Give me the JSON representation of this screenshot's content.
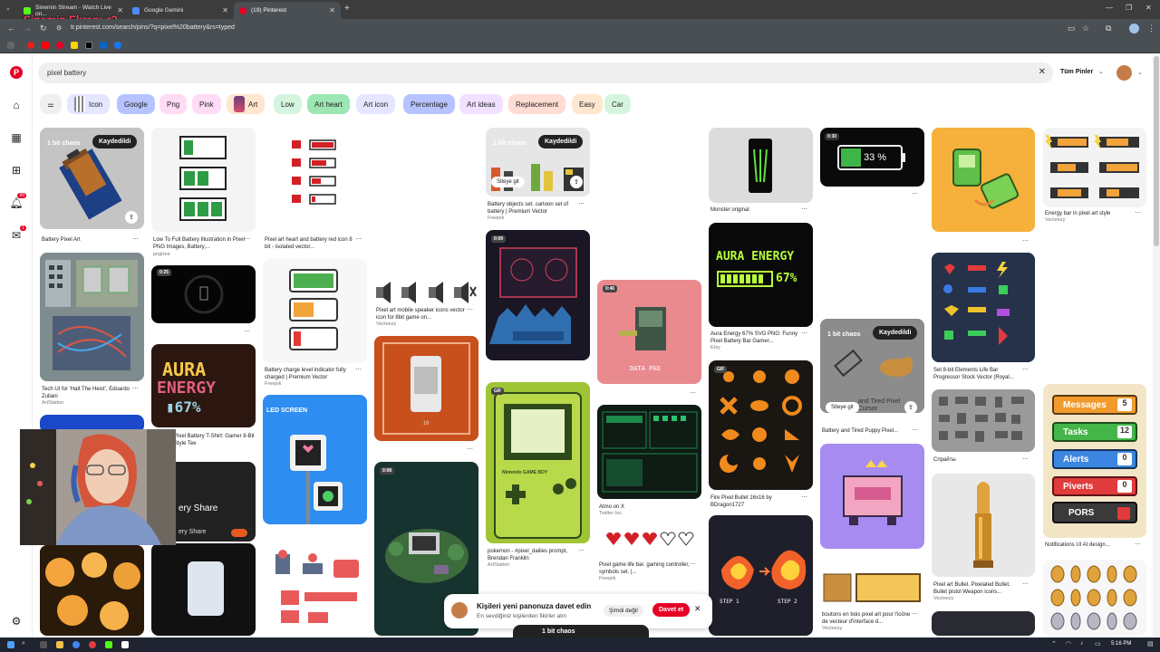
{
  "overlay": {
    "stream_title": "Sinemin Ekranı <3"
  },
  "browser": {
    "tabs": [
      {
        "title": "Sinemin Stream - Watch Live on...",
        "active": false,
        "favicon_color": "#53fc18"
      },
      {
        "title": "Google Gemini",
        "active": false,
        "favicon_color": "#4e8cf7"
      },
      {
        "title": "(19) Pinterest",
        "active": true,
        "favicon_color": "#e60023"
      }
    ],
    "url": "tr.pinterest.com/search/pins/?q=pixel%20battery&rs=typed",
    "bookmark_colors": [
      "#e62117",
      "#ff0000",
      "#e60023",
      "#ffd600",
      "#000000",
      "#0a66c2",
      "#1877f2"
    ]
  },
  "pinterest": {
    "search_query": "pixel battery",
    "all_pins_label": "Tüm Pinler",
    "notifications_badge": "99",
    "messages_badge": "1",
    "chips": [
      {
        "label": "Icon",
        "color": "#e4e7ff"
      },
      {
        "label": "Google",
        "color": "#b7c3ff"
      },
      {
        "label": "Png",
        "color": "#ffdcf5"
      },
      {
        "label": "Pink",
        "color": "#ffdcf5"
      },
      {
        "label": "Art",
        "color": "#ffe6cf"
      },
      {
        "label": "Low",
        "color": "#d6f5df"
      },
      {
        "label": "Art heart",
        "color": "#9ce7b3"
      },
      {
        "label": "Art icon",
        "color": "#e4e7ff"
      },
      {
        "label": "Percentage",
        "color": "#b7c3ff"
      },
      {
        "label": "Art ideas",
        "color": "#f1e0ff"
      },
      {
        "label": "Replacement",
        "color": "#ffdcd4"
      },
      {
        "label": "Easy",
        "color": "#ffe6cf"
      },
      {
        "label": "Car",
        "color": "#d6f5df"
      }
    ],
    "pins": {
      "p1": {
        "caption": "Battery Pixel Art",
        "board": "1 bit chaos",
        "save": "Kaydedildi"
      },
      "p2": {
        "caption": "Low To Full Battery Illustration in Pixel PNG Images, Battery,...",
        "source": "pngtree"
      },
      "p3": {
        "caption": "Pixel art heart and battery red icon 8 bit - isolated vector..."
      },
      "p4": {
        "caption": "Battery objects set. cartoon set of battery | Premium Vector",
        "source": "Freepik",
        "board": "1 bit chaos",
        "save": "Kaydedildi",
        "site": "Siteye git"
      },
      "p5": {
        "caption": "Monster original"
      },
      "p6": {
        "text": "33 %",
        "badge": "0:30"
      },
      "p7": {
        "caption": "Energy bar in pixel art style",
        "source": "Vecteezy"
      },
      "p8": {
        "caption": "Tech UI for 'Halt The Heist', Edoardo Zuliani",
        "source": "ArtStation"
      },
      "p9": {
        "caption": "Pixel art mobile speaker icons vector icon for 8bit game on...",
        "source": "Vecteezy"
      },
      "p10": {
        "caption": "Battery charge level indicator fully charged | Premium Vector",
        "source": "Freepik"
      },
      "p11": {
        "text": "AURA ENERGY 67%",
        "caption": "Aura Energy 67% SVG PNG: Funny Pixel Battery Bar Gamer...",
        "source": "Etsy"
      },
      "p12": {
        "text": "DATA PAD",
        "badge": "0:46"
      },
      "p13": {
        "caption": "Set 8-bit Elements Life Bar Progressor Stock Vector (Royal..."
      },
      "p14": {
        "caption": "Battery and Tired Puppy Pixel...",
        "board": "1 bit chaos",
        "save": "Kaydedildi",
        "site": "Siteye git",
        "overlay_text": "and Tired Pixel Cursor"
      },
      "p15": {
        "text": "AURA ENERGY 67%",
        "caption": "Pixel Battery T-Shirt: Gamer 8-Bit Style Tee"
      },
      "p16": {
        "caption": "Atmo on X",
        "source": "Twitter Inc."
      },
      "p17": {
        "caption": "Fire Pixel Bullet 16x16 by BDragon1727"
      },
      "p18": {
        "caption": "Спрайты"
      },
      "p19": {
        "text": "LED SCREEN"
      },
      "p20": {
        "caption": "pokemon - #pixel_dailies prompt, Brendan Franklin",
        "source": "ArtStation",
        "brand": "Nintendo GAME BOY"
      },
      "p21": {
        "caption": "Pixel game life bar. gaming controller, symbols set. |...",
        "source": "Freepik"
      },
      "p22": {
        "messages": "Messages",
        "messages_n": "5",
        "tasks": "Tasks",
        "tasks_n": "12",
        "alerts": "Alerts",
        "alerts_n": "0",
        "piverts": "Piverts",
        "piverts_n": "0",
        "pors": "PORS",
        "caption": "Notifications UI AI design..."
      },
      "p23": {
        "text": "ery Share",
        "sub": "ery Share"
      },
      "p24": {
        "step1": "STEP 1",
        "step2": "STEP 2"
      },
      "p25": {
        "caption": "boutons en bois pixel art pour l'icône de vecteur d'interface d...",
        "source": "Vecteezy"
      },
      "p26": {
        "caption": "Pixel art Bullet. Pixelated Bullet. Bullet pistol Weapon icons...",
        "source": "Vecteezy"
      },
      "p27": {
        "badge": "0:08"
      }
    },
    "toast": {
      "title": "Kişileri yeni panonuza davet edin",
      "subtitle": "En sevdiğiniz kişilerden fikirler alın",
      "later": "Şimdi değil",
      "invite": "Davet et"
    },
    "bottom_board": "1 bit chaos"
  },
  "taskbar": {
    "time": "5:16 PM"
  }
}
